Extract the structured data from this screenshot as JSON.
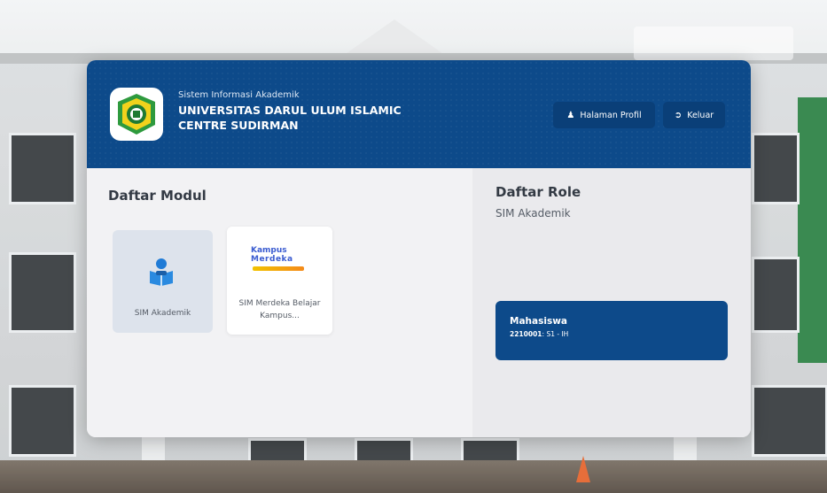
{
  "header": {
    "system_name": "Sistem Informasi Akademik",
    "university_name": "UNIVERSITAS DARUL ULUM ISLAMIC CENTRE SUDIRMAN",
    "profile_button": "Halaman Profil",
    "logout_button": "Keluar",
    "icons": {
      "profile": "user-icon",
      "logout": "logout-icon"
    }
  },
  "modules": {
    "title": "Daftar Modul",
    "items": [
      {
        "label": "SIM Akademik",
        "icon": "student-reading-icon"
      },
      {
        "label": "SIM Merdeka Belajar Kampus...",
        "logo_line1": "Kampus",
        "logo_line2": "Merdeka",
        "icon": "kampus-merdeka-logo"
      }
    ]
  },
  "roles": {
    "title": "Daftar Role",
    "subtitle": "SIM Akademik",
    "items": [
      {
        "name": "Mahasiswa",
        "code": "2210001",
        "detail": ": S1 - IH"
      }
    ]
  },
  "colors": {
    "primary": "#0d4a8a",
    "card_bg": "#f2f2f4",
    "module_active": "#dde3ec"
  }
}
